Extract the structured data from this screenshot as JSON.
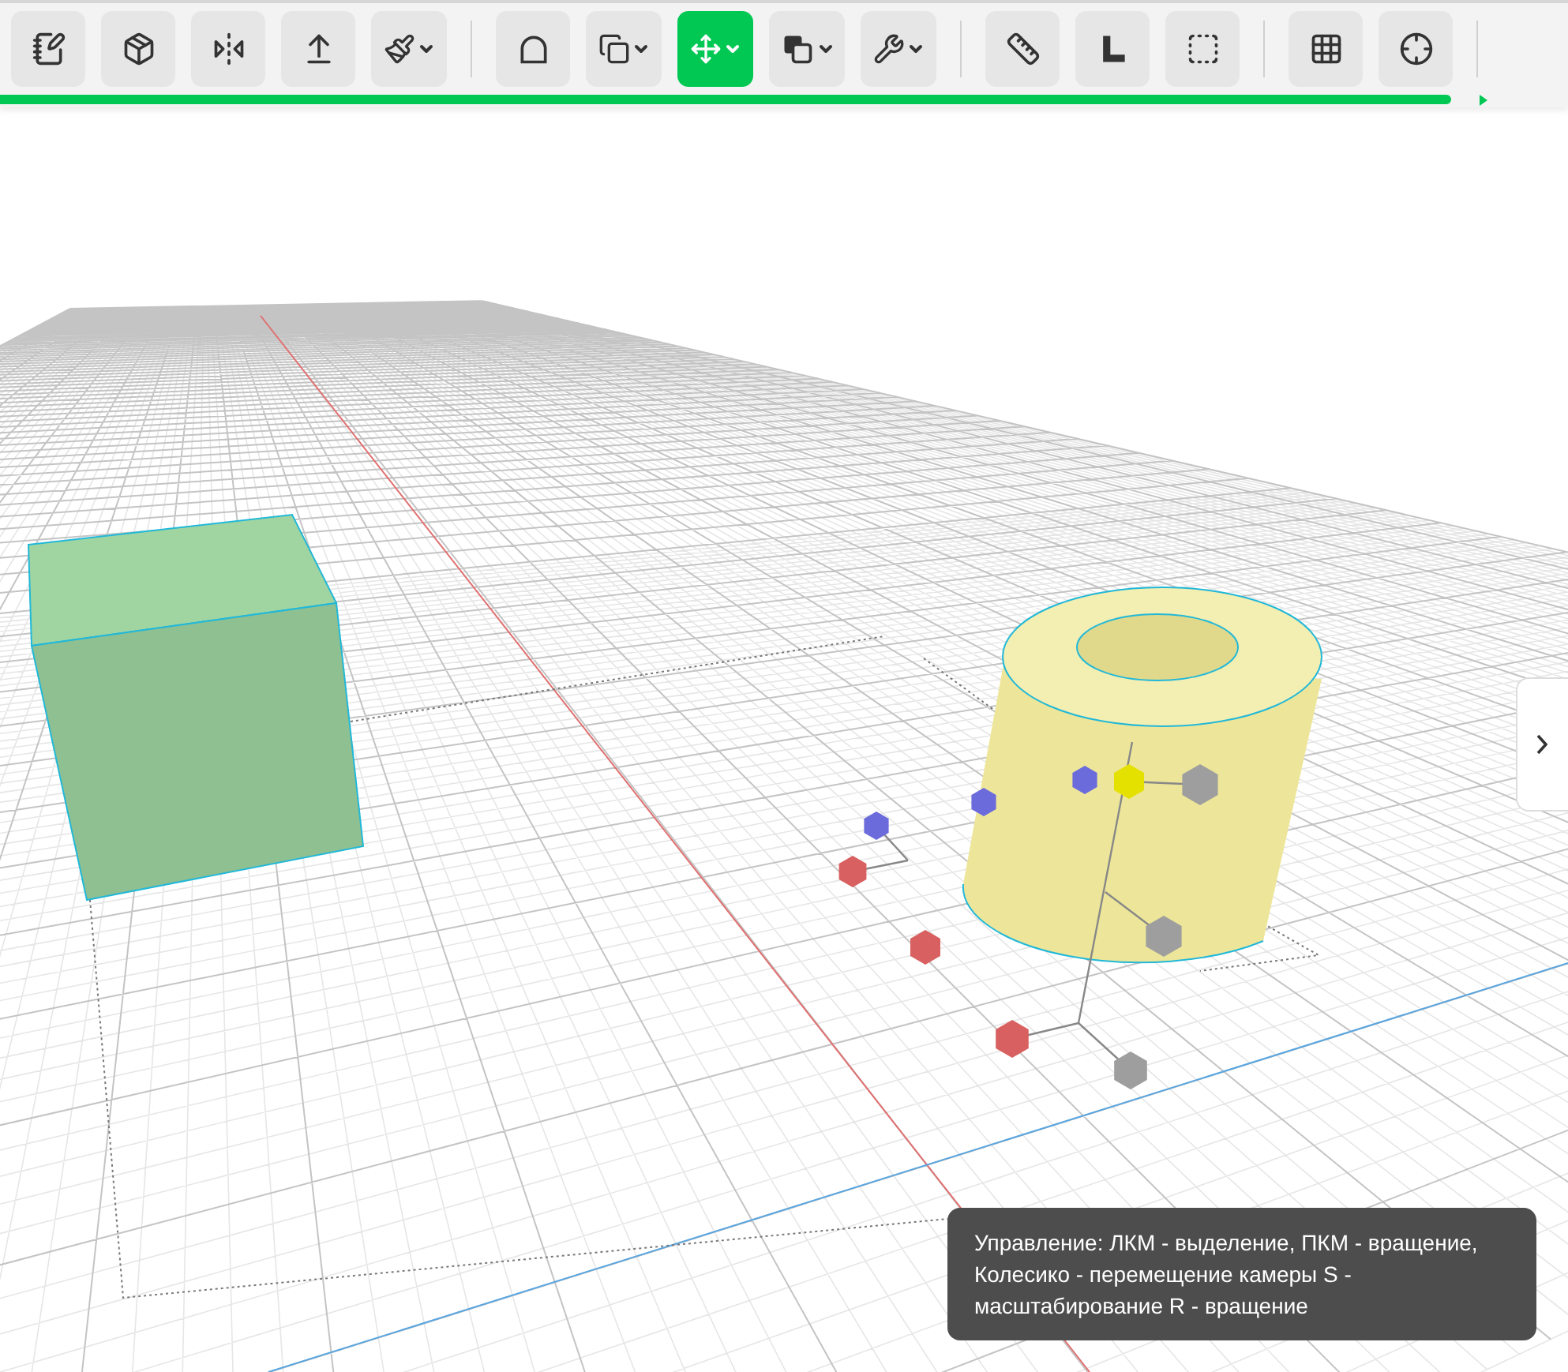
{
  "toolbar": {
    "groups": [
      {
        "buttons": [
          {
            "kind": "button",
            "selected": false
          },
          {
            "kind": "button",
            "selected": false
          },
          {
            "kind": "button",
            "selected": false
          },
          {
            "kind": "button",
            "selected": false
          },
          {
            "kind": "dropdown",
            "selected": false
          }
        ]
      },
      {
        "buttons": [
          {
            "kind": "button",
            "selected": false
          },
          {
            "kind": "dropdown",
            "selected": false
          },
          {
            "kind": "dropdown",
            "selected": true
          },
          {
            "kind": "dropdown",
            "selected": false
          },
          {
            "kind": "dropdown",
            "selected": false
          }
        ]
      },
      {
        "buttons": [
          {
            "kind": "button",
            "selected": false
          },
          {
            "kind": "button",
            "selected": false
          },
          {
            "kind": "button",
            "selected": false
          }
        ]
      },
      {
        "buttons": [
          {
            "kind": "button",
            "selected": false
          },
          {
            "kind": "button",
            "selected": false
          }
        ]
      }
    ]
  },
  "progress": {
    "level": 0.925
  },
  "side_panel": {
    "expanded": false
  },
  "hint": {
    "text": "Управление: ЛКМ - выделение, ПКМ - вращение, Колесико - перемещение камеры S - масштабирование R - вращение"
  }
}
